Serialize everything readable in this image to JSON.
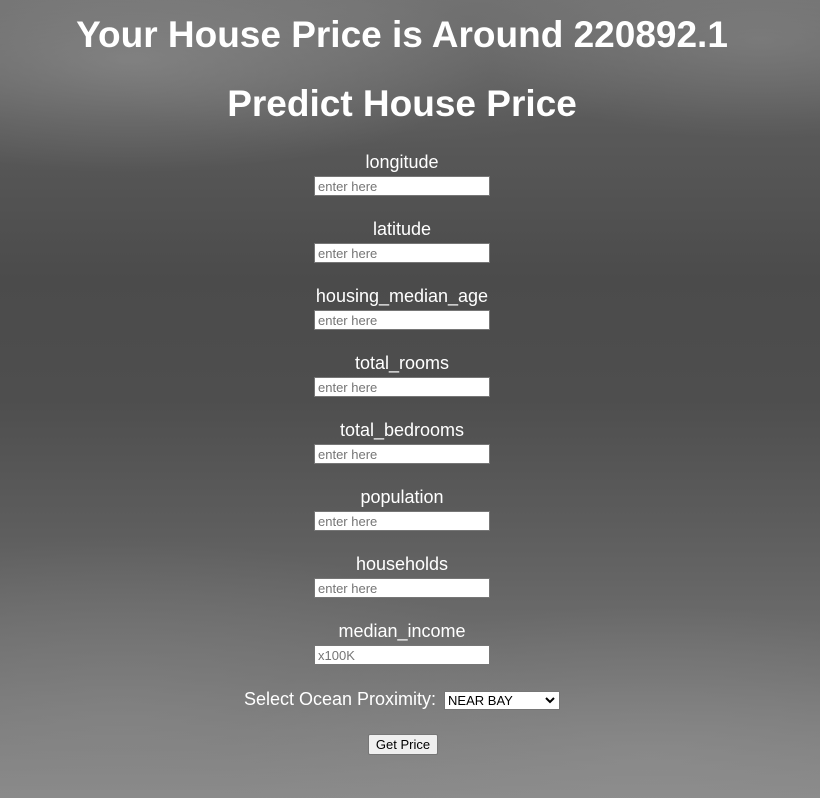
{
  "result": {
    "text": "Your House Price is Around 220892.1"
  },
  "form": {
    "title": "Predict House Price",
    "fields": [
      {
        "label": "longitude",
        "placeholder": "enter here"
      },
      {
        "label": "latitude",
        "placeholder": "enter here"
      },
      {
        "label": "housing_median_age",
        "placeholder": "enter here"
      },
      {
        "label": "total_rooms",
        "placeholder": "enter here"
      },
      {
        "label": "total_bedrooms",
        "placeholder": "enter here"
      },
      {
        "label": "population",
        "placeholder": "enter here"
      },
      {
        "label": "households",
        "placeholder": "enter here"
      },
      {
        "label": "median_income",
        "placeholder": "x100K"
      }
    ],
    "ocean_proximity": {
      "label": "Select Ocean Proximity:",
      "selected": "NEAR BAY"
    },
    "submit_label": "Get Price"
  },
  "icons": {
    "select_chevron": "chevron-down-icon"
  }
}
